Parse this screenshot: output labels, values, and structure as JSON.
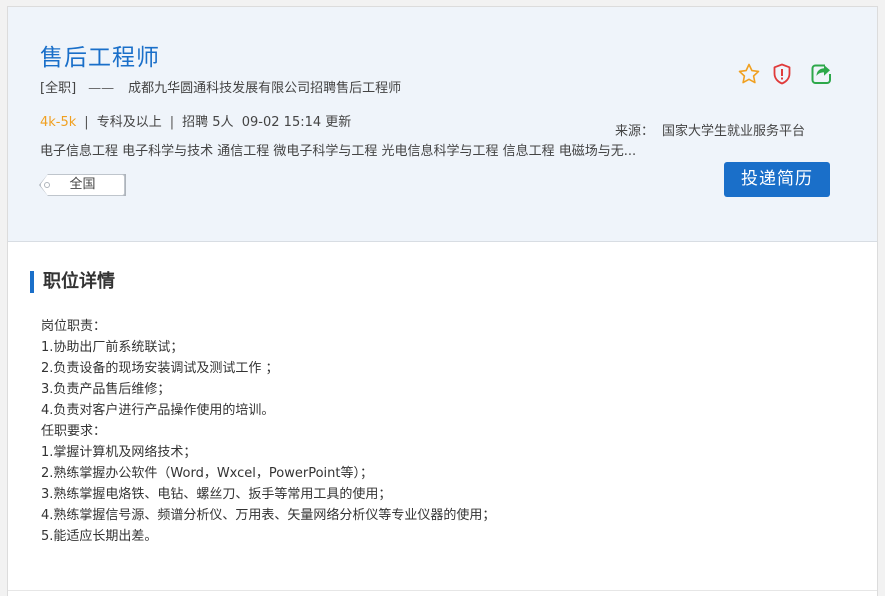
{
  "job": {
    "title": "售后工程师",
    "type": "[全职]",
    "dash": "——",
    "company_line": "成都九华圆通科技发展有限公司招聘售后工程师",
    "salary": "4k-5k",
    "education": "专科及以上",
    "headcount": "招聘 5人",
    "updated": "09-02 15:14 更新",
    "source_label": "来源：",
    "source_value": "国家大学生就业服务平台",
    "majors": "电子信息工程 电子科学与技术 通信工程 微电子科学与工程 光电信息科学与工程 信息工程 电磁场与无...",
    "location_tag": "全国",
    "apply_label": "投递简历",
    "separator": "|"
  },
  "icons": {
    "favorite": "star-icon",
    "report": "shield-warning-icon",
    "share": "share-icon"
  },
  "colors": {
    "brand": "#1a6fc9",
    "salary": "#f0a020",
    "star": "#f0a020",
    "report": "#e03a3a",
    "share": "#2da84a",
    "header_bg": "#eff4fa"
  },
  "details": {
    "section_title": "职位详情",
    "lines": [
      "岗位职责：",
      "1.协助出厂前系统联试；",
      "2.负责设备的现场安装调试及测试工作 ；",
      "3.负责产品售后维修；",
      "4.负责对客户进行产品操作使用的培训。",
      "任职要求：",
      "1.掌握计算机及网络技术；",
      "2.熟练掌握办公软件（Word，Wxcel，PowerPoint等）；",
      "3.熟练掌握电烙铁、电钻、螺丝刀、扳手等常用工具的使用；",
      "4.熟练掌握信号源、频谱分析仪、万用表、矢量网络分析仪等专业仪器的使用；",
      "5.能适应长期出差。"
    ]
  }
}
